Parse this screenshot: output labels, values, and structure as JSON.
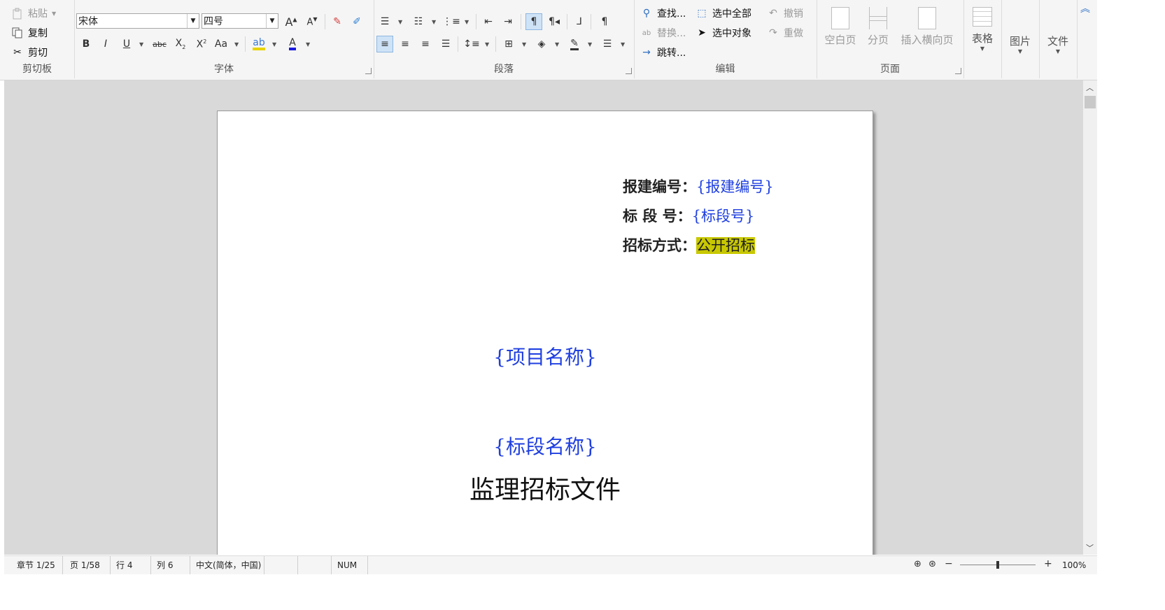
{
  "clipboard": {
    "paste_label": "粘贴",
    "copy_label": "复制",
    "cut_label": "剪切",
    "group_label": "剪切板"
  },
  "font": {
    "font_name": "宋体",
    "font_size": "四号",
    "group_label": "字体",
    "case_label": "Aa",
    "strike_label": "abc"
  },
  "paragraph": {
    "group_label": "段落"
  },
  "edit": {
    "find_label": "查找...",
    "replace_label": "替换...",
    "goto_label": "跳转...",
    "select_all_label": "选中全部",
    "select_object_label": "选中对象",
    "undo_label": "撤销",
    "redo_label": "重做",
    "group_label": "编辑"
  },
  "page_group": {
    "blank_page_label": "空白页",
    "page_break_label": "分页",
    "insert_landscape_label": "插入横向页",
    "group_label": "页面"
  },
  "insert": {
    "table_label": "表格",
    "image_label": "图片",
    "file_label": "文件"
  },
  "document": {
    "filing_number_label": "报建编号：",
    "filing_number_value": "{报建编号}",
    "section_number_label": "标 段 号：",
    "section_number_value": "{标段号}",
    "bidding_method_label": "招标方式：",
    "bidding_method_value": "公开招标",
    "project_name": "{项目名称}",
    "section_name": "{标段名称}",
    "doc_title": "监理招标文件"
  },
  "status": {
    "section": "章节 1/25",
    "page": "页 1/58",
    "line": "行 4",
    "column": "列 6",
    "language": "中文(简体，中国)",
    "num": "NUM",
    "zoom": "100%",
    "zoom_level": 0.5
  },
  "colors": {
    "placeholder_blue": "#1f3fe0",
    "highlight": "#c8c800",
    "selected_button": "#cfe3f7"
  }
}
